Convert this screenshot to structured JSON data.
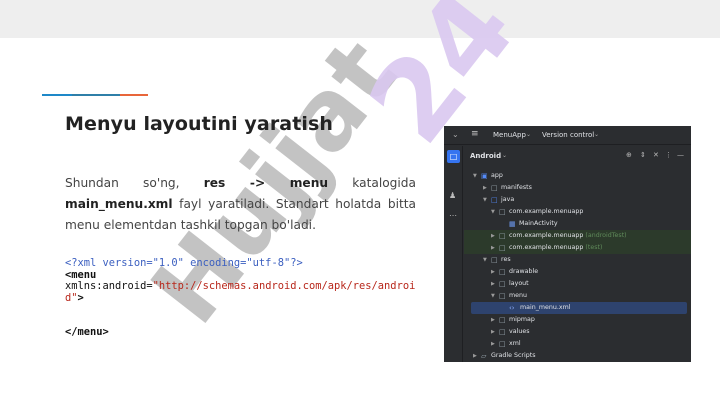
{
  "slide": {
    "title": "Menyu layoutini yaratish",
    "paragraph": {
      "p1": "Shundan so'ng, ",
      "b1": "res -> menu",
      "p2": " katalogida ",
      "b2": "main_menu.xml",
      "p3": " fayl yaratiladi. Standart holatda bitta menu elementdan tashkil topgan bo'ladi."
    },
    "code": {
      "line1": "<?xml version=\"1.0\" encoding=\"utf-8\"?>",
      "line2_tag": "<menu",
      "line3_attr": "xmlns:android=",
      "line3_value": "\"http://schemas.android.com/apk/res/androi",
      "line4_value": "d\"",
      "line4_end": ">",
      "line5_close": "</menu>"
    },
    "watermark": "Hujjat24",
    "colors": {
      "title": "#222222",
      "accent_blue": "#1e88c8",
      "accent_orange": "#e8663a",
      "watermark_gray": "#bdbdbd",
      "watermark_purple": "#d9c8f0"
    }
  },
  "ide": {
    "toolbar": {
      "project": "MenuApp",
      "vcs": "Version control",
      "menu_icon": "hamburger-icon"
    },
    "panel": {
      "title": "Android",
      "tools": [
        "target-icon",
        "expand-icon",
        "collapse-icon",
        "more-icon",
        "minimize-icon"
      ]
    },
    "tree": [
      {
        "label": "app",
        "icon": "module-icon"
      },
      {
        "label": "manifests",
        "icon": "folder-icon"
      },
      {
        "label": "java",
        "icon": "folder-icon"
      },
      {
        "label": "com.example.menuapp",
        "icon": "package-icon"
      },
      {
        "label": "MainActivity",
        "icon": "kotlin-class-icon"
      },
      {
        "label": "com.example.menuapp",
        "hint": "(androidTest)",
        "icon": "package-icon"
      },
      {
        "label": "com.example.menuapp",
        "hint": "(test)",
        "icon": "package-icon"
      },
      {
        "label": "res",
        "icon": "res-folder-icon"
      },
      {
        "label": "drawable",
        "icon": "folder-icon"
      },
      {
        "label": "layout",
        "icon": "folder-icon"
      },
      {
        "label": "menu",
        "icon": "folder-icon"
      },
      {
        "label": "main_menu.xml",
        "icon": "xml-file-icon"
      },
      {
        "label": "mipmap",
        "icon": "folder-icon"
      },
      {
        "label": "values",
        "icon": "folder-icon"
      },
      {
        "label": "xml",
        "icon": "folder-icon"
      },
      {
        "label": "Gradle Scripts",
        "icon": "gradle-icon"
      }
    ]
  }
}
